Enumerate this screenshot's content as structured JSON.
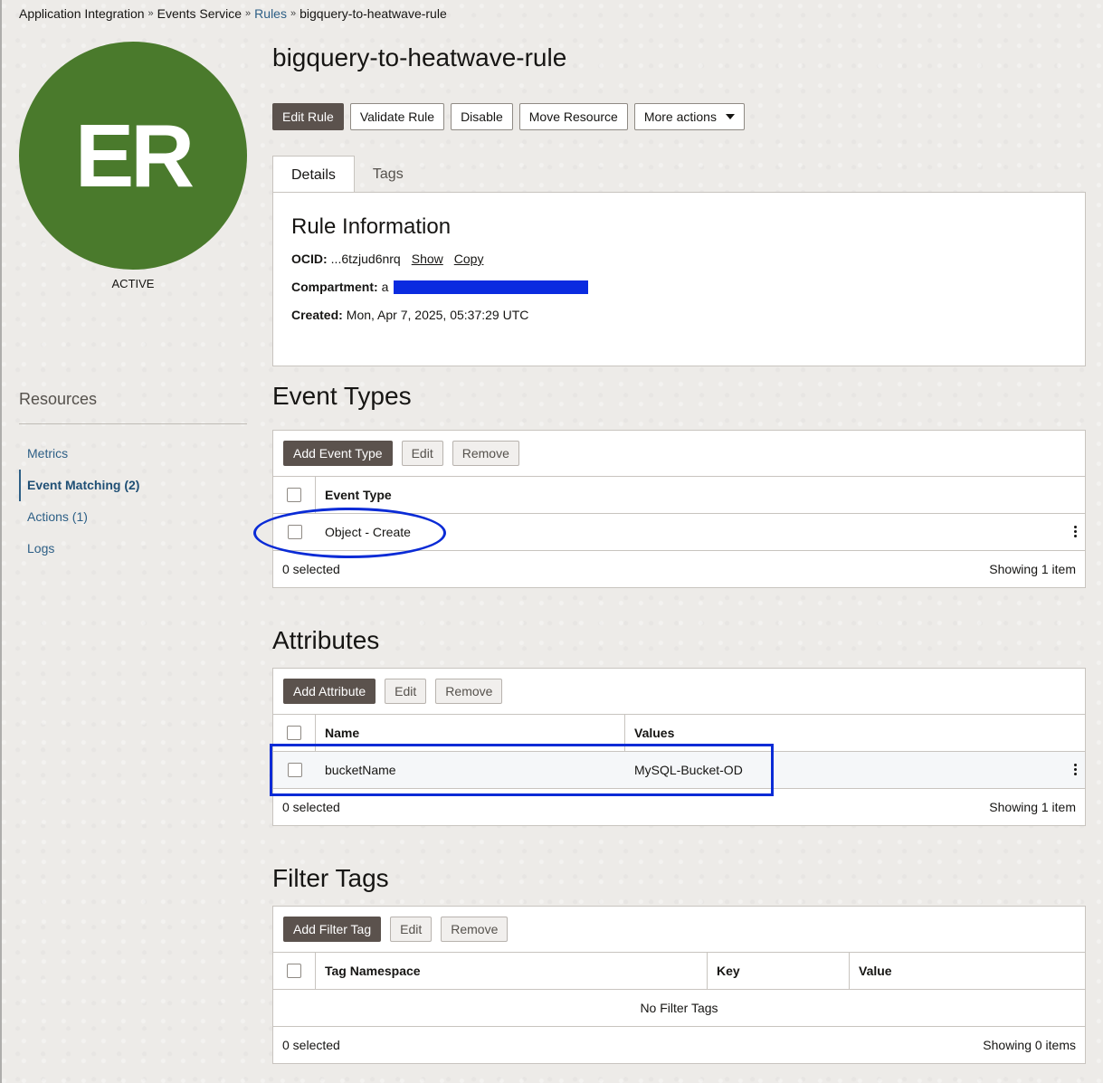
{
  "breadcrumb": {
    "items": [
      "Application Integration",
      "Events Service",
      "Rules",
      "bigquery-to-heatwave-rule"
    ],
    "separator": "»"
  },
  "avatar": {
    "initials": "ER",
    "status": "ACTIVE",
    "color": "#4a7a2c"
  },
  "resources": {
    "title": "Resources",
    "items": [
      {
        "label": "Metrics"
      },
      {
        "label": "Event Matching (2)"
      },
      {
        "label": "Actions (1)"
      },
      {
        "label": "Logs"
      }
    ],
    "active": "Event Matching (2)"
  },
  "page": {
    "title": "bigquery-to-heatwave-rule"
  },
  "actions": {
    "edit_rule": "Edit Rule",
    "validate_rule": "Validate Rule",
    "disable": "Disable",
    "move_resource": "Move Resource",
    "more_actions": "More actions"
  },
  "tabs": {
    "details": "Details",
    "tags": "Tags"
  },
  "details": {
    "title": "Rule Information",
    "ocid_label": "OCID:",
    "ocid_value": "...6tzjud6nrq",
    "show": "Show",
    "copy": "Copy",
    "compartment_label": "Compartment:",
    "compartment_prefix": "a",
    "created_label": "Created:",
    "created_value": "Mon, Apr 7, 2025, 05:37:29 UTC"
  },
  "event_types": {
    "title": "Event Types",
    "add": "Add Event Type",
    "edit": "Edit",
    "remove": "Remove",
    "column": "Event Type",
    "rows": [
      "Object - Create"
    ],
    "selected": "0 selected",
    "showing": "Showing 1 item"
  },
  "attributes": {
    "title": "Attributes",
    "add": "Add Attribute",
    "edit": "Edit",
    "remove": "Remove",
    "columns": [
      "Name",
      "Values"
    ],
    "rows": [
      {
        "name": "bucketName",
        "values": "MySQL-Bucket-OD"
      }
    ],
    "selected": "0 selected",
    "showing": "Showing 1 item"
  },
  "filter_tags": {
    "title": "Filter Tags",
    "add": "Add Filter Tag",
    "edit": "Edit",
    "remove": "Remove",
    "columns": [
      "Tag Namespace",
      "Key",
      "Value"
    ],
    "empty": "No Filter Tags",
    "selected": "0 selected",
    "showing": "Showing 0 items"
  },
  "annotation_color": "#0a2bd6",
  "redaction_color": "#0a2be0"
}
